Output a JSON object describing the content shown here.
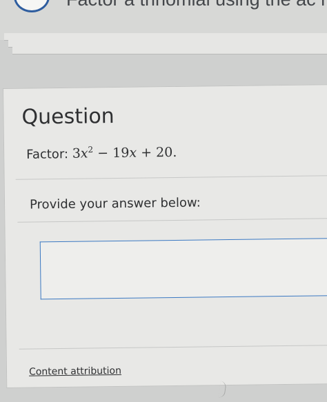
{
  "top": {
    "title": "Factor a trinomial using the ac method"
  },
  "question": {
    "heading": "Question",
    "prompt_prefix": "Factor: ",
    "expression": {
      "term1_coef": "3",
      "term1_var": "x",
      "term1_exp": "2",
      "op1": " − ",
      "term2_coef": "19",
      "term2_var": "x",
      "op2": " + ",
      "constant": "20",
      "end": "."
    }
  },
  "answer": {
    "instruction": "Provide your answer below:",
    "value": ""
  },
  "footer": {
    "attribution_label": "Content attribution"
  },
  "colors": {
    "accent": "#3a78c2",
    "icon_ring": "#2e5d9f"
  }
}
